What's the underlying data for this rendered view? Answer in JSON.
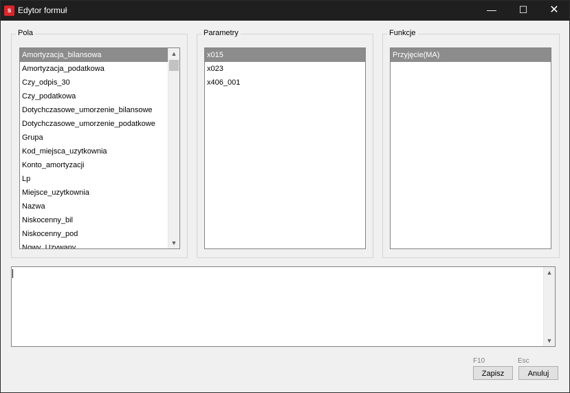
{
  "window": {
    "title": "Edytor formuł",
    "icon_letter": "s",
    "controls": {
      "minimize": "—",
      "maximize": "☐",
      "close": "✕"
    }
  },
  "pola": {
    "label": "Pola",
    "items": [
      "Amortyzacja_bilansowa",
      "Amortyzacja_podatkowa",
      "Czy_odpis_30",
      "Czy_podatkowa",
      "Dotychczasowe_umorzenie_bilansowe",
      "Dotychczasowe_umorzenie_podatkowe",
      "Grupa",
      "Kod_miejsca_uzytkownia",
      "Konto_amortyzacji",
      "Lp",
      "Miejsce_uzytkownia",
      "Nazwa",
      "Niskocenny_bil",
      "Niskocenny_pod",
      "Nowy_Uzywany"
    ],
    "selected_index": 0
  },
  "parametry": {
    "label": "Parametry",
    "items": [
      "x015",
      "x023",
      "x406_001"
    ],
    "selected_index": 0
  },
  "funkcje": {
    "label": "Funkcje",
    "items": [
      "Przyjęcie(MA)"
    ],
    "selected_index": 0
  },
  "formula": {
    "value": ""
  },
  "buttons": {
    "save_label": "Zapisz",
    "save_shortcut": "F10",
    "cancel_label": "Anuluj",
    "cancel_shortcut": "Esc"
  },
  "colors": {
    "titlebar": "#1f1f1f",
    "selection": "#8c8c8c",
    "app_icon": "#d9262c"
  }
}
